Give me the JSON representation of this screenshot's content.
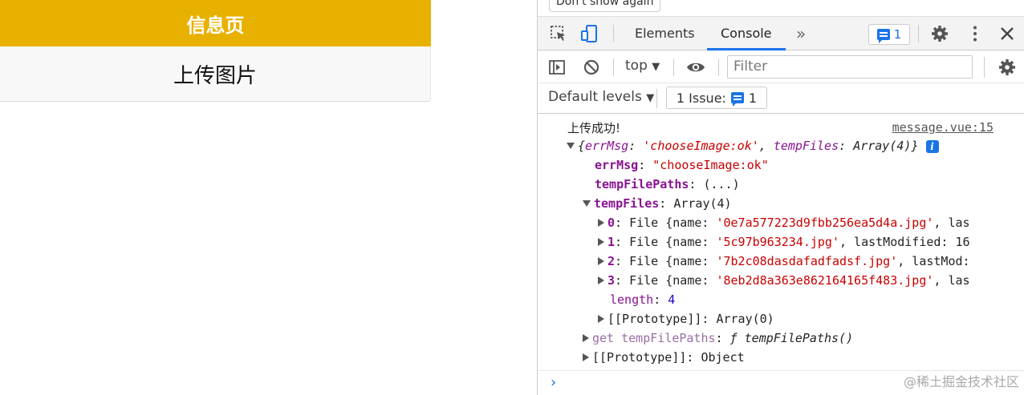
{
  "app": {
    "header_title": "信息页",
    "upload_button": "上传图片"
  },
  "devtools": {
    "dont_show_again": "Don't show again",
    "tabs": {
      "elements": "Elements",
      "console": "Console",
      "more": "»"
    },
    "issues_count": "1",
    "context": "top",
    "context_caret": "▼",
    "filter_placeholder": "Filter",
    "default_levels": "Default levels",
    "levels_caret": "▼",
    "issue_label": "1 Issue:",
    "issue_count": "1",
    "icons": [
      "inspect-icon",
      "device-toggle-icon",
      "message-icon",
      "gear-icon",
      "kebab-menu-icon",
      "close-icon",
      "sidebar-toggle-icon",
      "clear-icon",
      "eye-icon"
    ]
  },
  "console": {
    "message": "上传成功!",
    "source": "message.vue:15",
    "object_summary_open": "{",
    "object_summary_key1": "errMsg",
    "object_summary_val1": "'chooseImage:ok'",
    "object_summary_key2": "tempFiles",
    "object_summary_val2": "Array(4)",
    "object_summary_close": "}",
    "info_glyph": "i",
    "errMsg_key": "errMsg",
    "errMsg_val": "\"chooseImage:ok\"",
    "tempFilePaths_key": "tempFilePaths",
    "tempFilePaths_val": "(...)",
    "tempFiles_key": "tempFiles",
    "tempFiles_val": "Array(4)",
    "files": [
      {
        "idx": "0",
        "prefix": "File {name: ",
        "name": "'0e7a577223d9fbb256ea5d4a.jpg'",
        "suffix": ", las"
      },
      {
        "idx": "1",
        "prefix": "File {name: ",
        "name": "'5c97b963234.jpg'",
        "suffix": ", lastModified: 16"
      },
      {
        "idx": "2",
        "prefix": "File {name: ",
        "name": "'7b2c08dasdafadfadsf.jpg'",
        "suffix": ", lastMod:"
      },
      {
        "idx": "3",
        "prefix": "File {name: ",
        "name": "'8eb2d8a363e862164165f483.jpg'",
        "suffix": ", las"
      }
    ],
    "length_key": "length",
    "length_val": "4",
    "proto_array_key": "[[Prototype]]",
    "proto_array_val": "Array(0)",
    "getter_key": "get tempFilePaths",
    "getter_val": "ƒ tempFilePaths()",
    "proto_obj_key": "[[Prototype]]",
    "proto_obj_val": "Object",
    "prompt": "›"
  },
  "watermark": "@稀土掘金技术社区"
}
